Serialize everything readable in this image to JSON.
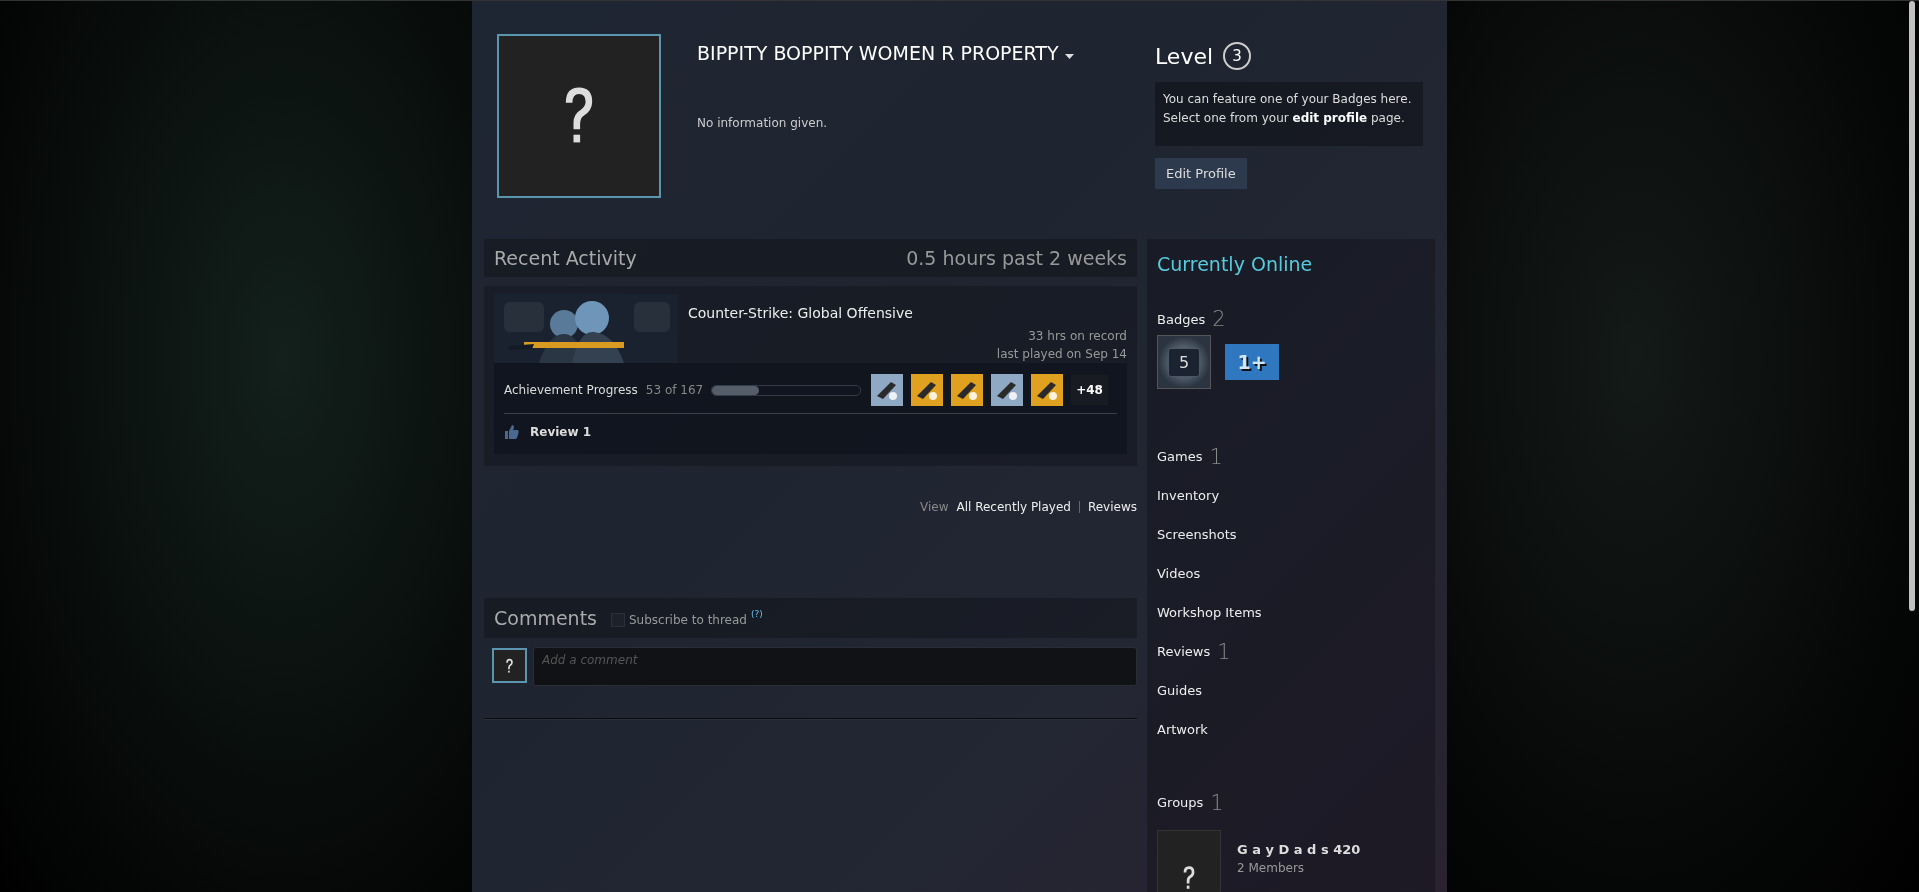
{
  "profile": {
    "name": "BIPPITY BOPPITY WOMEN R PROPERTY",
    "summary": "No information given.",
    "level_label": "Level",
    "level": "3",
    "badge_note": "You can feature one of your Badges here. Select one from your **edit profile** page.",
    "edit_button": "Edit Profile"
  },
  "recent_activity": {
    "title": "Recent Activity",
    "playtime": "0.5 hours past 2 weeks",
    "game": {
      "name": "Counter-Strike: Global Offensive",
      "hours": "33 hrs on record",
      "last_played": "last played on Sep 14",
      "achievement_label": "Achievement Progress",
      "achievement_count": "53 of 167",
      "level": 0.317,
      "achievements": [
        {
          "color": "#8fa9c4"
        },
        {
          "color": "#e0a020"
        },
        {
          "color": "#e0a020"
        },
        {
          "color": "#8fa9c4"
        },
        {
          "color": "#e0a020"
        }
      ],
      "more_achievements": "+48",
      "review": "Review 1"
    },
    "view_label": "View",
    "links": [
      "All Recently Played",
      "Reviews"
    ]
  },
  "comments": {
    "title": "Comments",
    "subscribe": {
      "label": "Subscribe to thread",
      "checked": false
    },
    "help": "(?)",
    "input": {
      "placeholder": "Add a comment"
    }
  },
  "sidebar": {
    "status": "Currently Online",
    "badges_label": "Badges",
    "badges_count": "2",
    "badges": [
      {
        "kind": "plate",
        "label": "5"
      },
      {
        "kind": "ribbon",
        "label": "1+"
      }
    ],
    "items": [
      {
        "label": "Games",
        "count": "1"
      },
      {
        "label": "Inventory"
      },
      {
        "label": "Screenshots"
      },
      {
        "label": "Videos"
      },
      {
        "label": "Workshop Items"
      },
      {
        "label": "Reviews",
        "count": "1"
      },
      {
        "label": "Guides"
      },
      {
        "label": "Artwork"
      }
    ],
    "groups_label": "Groups",
    "groups_count": "1",
    "groups": [
      {
        "name": "G a y D a d s 420",
        "members": "2 Members"
      }
    ]
  }
}
